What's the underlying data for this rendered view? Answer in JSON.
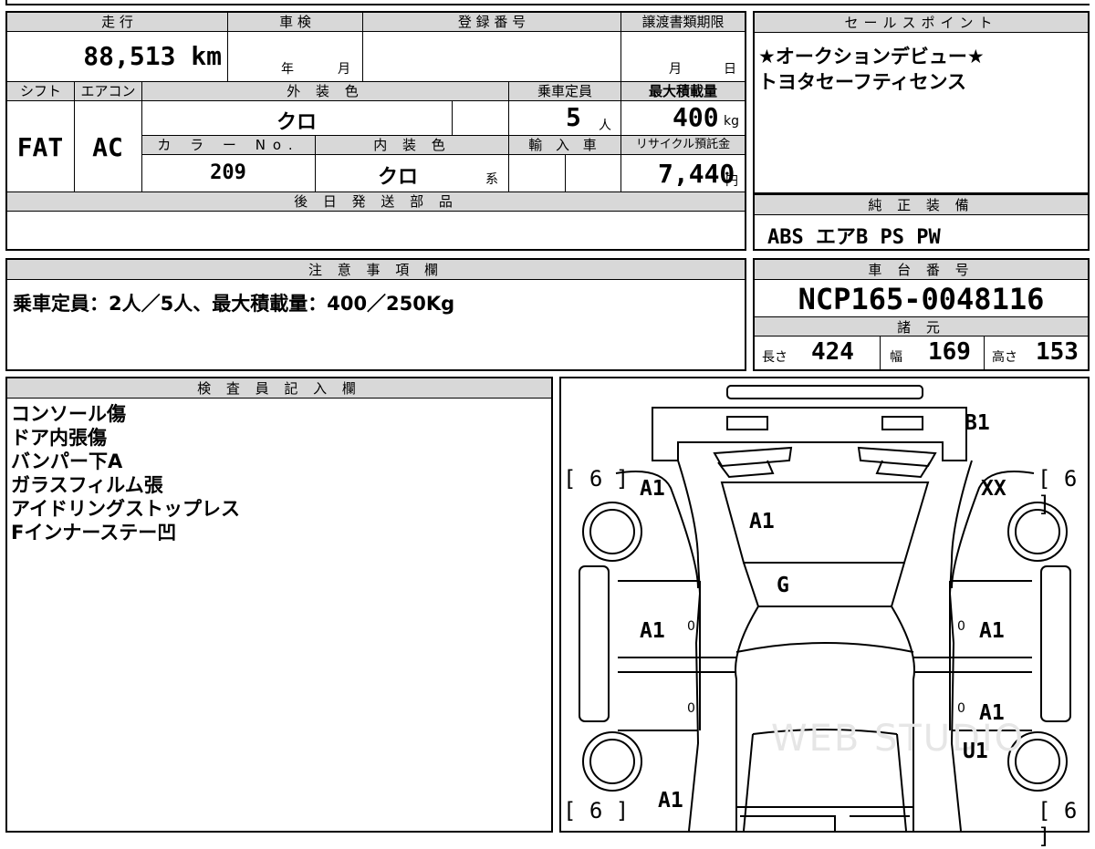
{
  "labels": {
    "mileage": "走 行",
    "shaken": "車 検",
    "reg_no": "登 録 番 号",
    "transfer": "譲渡書類期限",
    "sales": "セールスポイント",
    "shift": "シフト",
    "ac": "エアコン",
    "ext_color": "外 装 色",
    "capacity": "乗車定員",
    "max_load": "最大積載量",
    "color_no": "カ ラ ー No.",
    "int_color": "内 装 色",
    "import": "輸 入 車",
    "recycle": "リサイクル預託金",
    "later_parts": "後 日 発 送 部 品",
    "genuine": "純 正 装 備",
    "notes": "注 意 事 項 欄",
    "chassis": "車 台 番 号",
    "specs": "諸 元",
    "inspector": "検 査 員 記 入 欄"
  },
  "values": {
    "mileage": "88,513 km",
    "shaken_year": "年",
    "shaken_month": "月",
    "transfer_month": "月",
    "transfer_day": "日",
    "shift": "FAT",
    "ac": "AC",
    "ext_color": "クロ",
    "capacity": "5",
    "capacity_unit": "人",
    "max_load": "400",
    "max_load_unit": "kg",
    "color_no": "209",
    "int_color": "クロ",
    "int_suffix": "系",
    "recycle": "7,440",
    "recycle_unit": "円",
    "genuine": "ABS エアB PS PW",
    "notes": "乗車定員：2人／5人、最大積載量：400／250Kg",
    "chassis": "NCP165-0048116",
    "length_label": "長さ",
    "length": "424",
    "width_label": "幅",
    "width": "169",
    "height_label": "高さ",
    "height": "153"
  },
  "sales_points": [
    "★オークションデビュー★",
    "トヨタセーフティセンス"
  ],
  "inspector_notes": [
    "コンソール傷",
    "ドア内張傷",
    "バンパー下A",
    "ガラスフィルム張",
    "アイドリングストップレス",
    "Fインナーステー凹"
  ],
  "diagram": {
    "marks": [
      "B1",
      "A1",
      "XX",
      "A1",
      "G",
      "A1",
      "A1",
      "A1",
      "U1",
      "A1"
    ],
    "tires": [
      "[ 6 ]",
      "[ 6 ]",
      "[ 6 ]",
      "[ 6 ]"
    ],
    "zeros": [
      "0",
      "0",
      "0",
      "0"
    ],
    "watermark": "WEB STUDIO"
  }
}
